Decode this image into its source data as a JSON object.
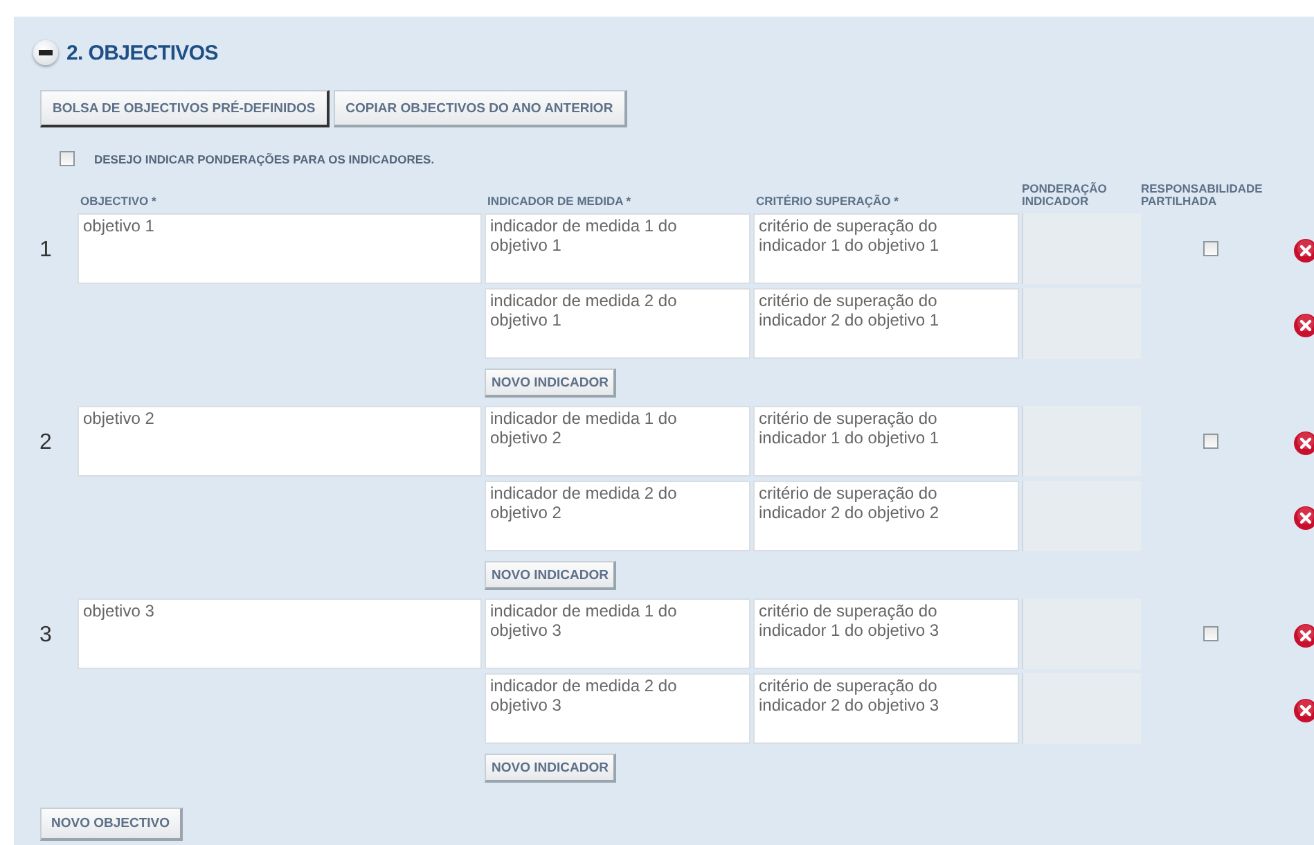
{
  "section": {
    "title": "2. OBJECTIVOS",
    "expanded": true
  },
  "toolbar": [
    {
      "label": "BOLSA DE OBJECTIVOS PRÉ-DEFINIDOS",
      "selected": true
    },
    {
      "label": "COPIAR OBJECTIVOS DO ANO ANTERIOR",
      "selected": false
    }
  ],
  "weights_option": {
    "label": "DESEJO INDICAR PONDERAÇÕES PARA OS INDICADORES.",
    "checked": false
  },
  "columns": [
    "OBJECTIVO *",
    "INDICADOR DE MEDIDA *",
    "CRITÉRIO SUPERAÇÃO *",
    "PONDERAÇÃO INDICADOR",
    "RESPONSABILIDADE PARTILHADA"
  ],
  "objectives": [
    {
      "number": "1",
      "text": "objetivo 1",
      "shared": false,
      "add_indicator": "NOVO INDICADOR",
      "indicators": [
        {
          "measure": "indicador de medida 1 do objetivo 1",
          "criterion": "critério de superação do indicador 1 do objetivo 1"
        },
        {
          "measure": "indicador de medida 2 do objetivo 1",
          "criterion": "critério de superação do indicador 2 do objetivo 1"
        }
      ]
    },
    {
      "number": "2",
      "text": "objetivo 2",
      "shared": false,
      "add_indicator": "NOVO INDICADOR",
      "indicators": [
        {
          "measure": "indicador de medida 1 do objetivo 2",
          "criterion": "critério de superação do indicador 1 do objetivo 1"
        },
        {
          "measure": "indicador de medida 2 do objetivo 2",
          "criterion": "critério de superação do indicador 2 do objetivo 2"
        }
      ]
    },
    {
      "number": "3",
      "text": "objetivo 3",
      "shared": false,
      "add_indicator": "NOVO INDICADOR",
      "indicators": [
        {
          "measure": "indicador de medida 1 do objetivo 3",
          "criterion": "critério de superação do indicador 1 do objetivo 3"
        },
        {
          "measure": "indicador de medida 2 do objetivo 3",
          "criterion": "critério de superação do indicador 2 do objetivo 3"
        }
      ]
    }
  ],
  "add_objective": "NOVO OBJECTIVO"
}
